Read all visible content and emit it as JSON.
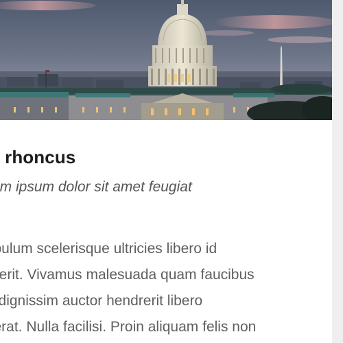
{
  "hero_image": {
    "subject": "capitol-building-dusk-photo"
  },
  "article": {
    "title": "am rhoncus",
    "subtitle": "em ipsum dolor sit amet feugiat",
    "body_lines": [
      "tibulum scelerisque ultricies libero id",
      "drerit. Vivamus malesuada quam faucibus",
      "e dignissim auctor hendrerit libero",
      "cerat. Nulla facilisi. Proin aliquam felis non"
    ]
  },
  "colors": {
    "title": "#1d1d1d",
    "subtitle": "#555555",
    "body": "#5f5f5f",
    "card_bg": "#ffffff",
    "page_bg": "#f1f1f1"
  }
}
